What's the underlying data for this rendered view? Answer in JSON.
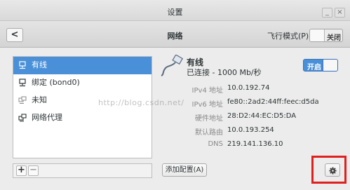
{
  "window": {
    "title": "设置",
    "minimize_label": "_",
    "close_label": "×"
  },
  "header": {
    "back_label": "<",
    "title": "网络",
    "airplane_mode_label": "飞行模式(P)",
    "airplane_mode_state": "关闭"
  },
  "sidebar": {
    "items": [
      {
        "label": "有线",
        "icon": "wired-network-icon",
        "selected": true
      },
      {
        "label": "绑定 (bond0)",
        "icon": "wired-network-icon",
        "selected": false
      },
      {
        "label": "未知",
        "icon": "network-unknown-icon",
        "selected": false
      },
      {
        "label": "网络代理",
        "icon": "network-proxy-icon",
        "selected": false
      }
    ],
    "add_label": "+",
    "remove_label": "−"
  },
  "connection": {
    "name": "有线",
    "status": "已连接 - 1000 Mb/秒",
    "switch_state": "开启",
    "details": [
      {
        "label": "IPv4 地址",
        "value": "10.0.192.74"
      },
      {
        "label": "IPv6 地址",
        "value": "fe80::2ad2:44ff:feec:d5da"
      },
      {
        "label": "硬件地址",
        "value": "28:D2:44:EC:D5:DA"
      },
      {
        "label": "默认路由",
        "value": "10.0.193.254"
      },
      {
        "label": "DNS",
        "value": "219.141.136.10"
      }
    ]
  },
  "buttons": {
    "add_config": "添加配置(A)"
  },
  "watermark": "http://blog.csdn.net/",
  "colors": {
    "accent": "#4a90d9",
    "highlight": "#e02020"
  }
}
